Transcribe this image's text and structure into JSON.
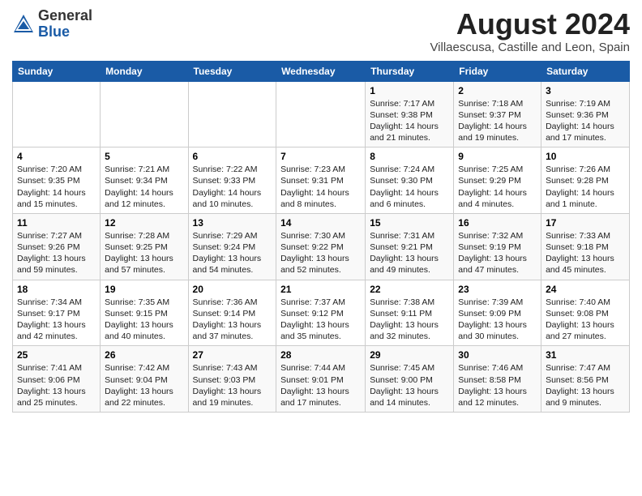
{
  "header": {
    "logo_general": "General",
    "logo_blue": "Blue",
    "month_year": "August 2024",
    "location": "Villaescusa, Castille and Leon, Spain"
  },
  "days_of_week": [
    "Sunday",
    "Monday",
    "Tuesday",
    "Wednesday",
    "Thursday",
    "Friday",
    "Saturday"
  ],
  "weeks": [
    [
      {
        "day": "",
        "content": ""
      },
      {
        "day": "",
        "content": ""
      },
      {
        "day": "",
        "content": ""
      },
      {
        "day": "",
        "content": ""
      },
      {
        "day": "1",
        "content": "Sunrise: 7:17 AM\nSunset: 9:38 PM\nDaylight: 14 hours\nand 21 minutes."
      },
      {
        "day": "2",
        "content": "Sunrise: 7:18 AM\nSunset: 9:37 PM\nDaylight: 14 hours\nand 19 minutes."
      },
      {
        "day": "3",
        "content": "Sunrise: 7:19 AM\nSunset: 9:36 PM\nDaylight: 14 hours\nand 17 minutes."
      }
    ],
    [
      {
        "day": "4",
        "content": "Sunrise: 7:20 AM\nSunset: 9:35 PM\nDaylight: 14 hours\nand 15 minutes."
      },
      {
        "day": "5",
        "content": "Sunrise: 7:21 AM\nSunset: 9:34 PM\nDaylight: 14 hours\nand 12 minutes."
      },
      {
        "day": "6",
        "content": "Sunrise: 7:22 AM\nSunset: 9:33 PM\nDaylight: 14 hours\nand 10 minutes."
      },
      {
        "day": "7",
        "content": "Sunrise: 7:23 AM\nSunset: 9:31 PM\nDaylight: 14 hours\nand 8 minutes."
      },
      {
        "day": "8",
        "content": "Sunrise: 7:24 AM\nSunset: 9:30 PM\nDaylight: 14 hours\nand 6 minutes."
      },
      {
        "day": "9",
        "content": "Sunrise: 7:25 AM\nSunset: 9:29 PM\nDaylight: 14 hours\nand 4 minutes."
      },
      {
        "day": "10",
        "content": "Sunrise: 7:26 AM\nSunset: 9:28 PM\nDaylight: 14 hours\nand 1 minute."
      }
    ],
    [
      {
        "day": "11",
        "content": "Sunrise: 7:27 AM\nSunset: 9:26 PM\nDaylight: 13 hours\nand 59 minutes."
      },
      {
        "day": "12",
        "content": "Sunrise: 7:28 AM\nSunset: 9:25 PM\nDaylight: 13 hours\nand 57 minutes."
      },
      {
        "day": "13",
        "content": "Sunrise: 7:29 AM\nSunset: 9:24 PM\nDaylight: 13 hours\nand 54 minutes."
      },
      {
        "day": "14",
        "content": "Sunrise: 7:30 AM\nSunset: 9:22 PM\nDaylight: 13 hours\nand 52 minutes."
      },
      {
        "day": "15",
        "content": "Sunrise: 7:31 AM\nSunset: 9:21 PM\nDaylight: 13 hours\nand 49 minutes."
      },
      {
        "day": "16",
        "content": "Sunrise: 7:32 AM\nSunset: 9:19 PM\nDaylight: 13 hours\nand 47 minutes."
      },
      {
        "day": "17",
        "content": "Sunrise: 7:33 AM\nSunset: 9:18 PM\nDaylight: 13 hours\nand 45 minutes."
      }
    ],
    [
      {
        "day": "18",
        "content": "Sunrise: 7:34 AM\nSunset: 9:17 PM\nDaylight: 13 hours\nand 42 minutes."
      },
      {
        "day": "19",
        "content": "Sunrise: 7:35 AM\nSunset: 9:15 PM\nDaylight: 13 hours\nand 40 minutes."
      },
      {
        "day": "20",
        "content": "Sunrise: 7:36 AM\nSunset: 9:14 PM\nDaylight: 13 hours\nand 37 minutes."
      },
      {
        "day": "21",
        "content": "Sunrise: 7:37 AM\nSunset: 9:12 PM\nDaylight: 13 hours\nand 35 minutes."
      },
      {
        "day": "22",
        "content": "Sunrise: 7:38 AM\nSunset: 9:11 PM\nDaylight: 13 hours\nand 32 minutes."
      },
      {
        "day": "23",
        "content": "Sunrise: 7:39 AM\nSunset: 9:09 PM\nDaylight: 13 hours\nand 30 minutes."
      },
      {
        "day": "24",
        "content": "Sunrise: 7:40 AM\nSunset: 9:08 PM\nDaylight: 13 hours\nand 27 minutes."
      }
    ],
    [
      {
        "day": "25",
        "content": "Sunrise: 7:41 AM\nSunset: 9:06 PM\nDaylight: 13 hours\nand 25 minutes."
      },
      {
        "day": "26",
        "content": "Sunrise: 7:42 AM\nSunset: 9:04 PM\nDaylight: 13 hours\nand 22 minutes."
      },
      {
        "day": "27",
        "content": "Sunrise: 7:43 AM\nSunset: 9:03 PM\nDaylight: 13 hours\nand 19 minutes."
      },
      {
        "day": "28",
        "content": "Sunrise: 7:44 AM\nSunset: 9:01 PM\nDaylight: 13 hours\nand 17 minutes."
      },
      {
        "day": "29",
        "content": "Sunrise: 7:45 AM\nSunset: 9:00 PM\nDaylight: 13 hours\nand 14 minutes."
      },
      {
        "day": "30",
        "content": "Sunrise: 7:46 AM\nSunset: 8:58 PM\nDaylight: 13 hours\nand 12 minutes."
      },
      {
        "day": "31",
        "content": "Sunrise: 7:47 AM\nSunset: 8:56 PM\nDaylight: 13 hours\nand 9 minutes."
      }
    ]
  ]
}
